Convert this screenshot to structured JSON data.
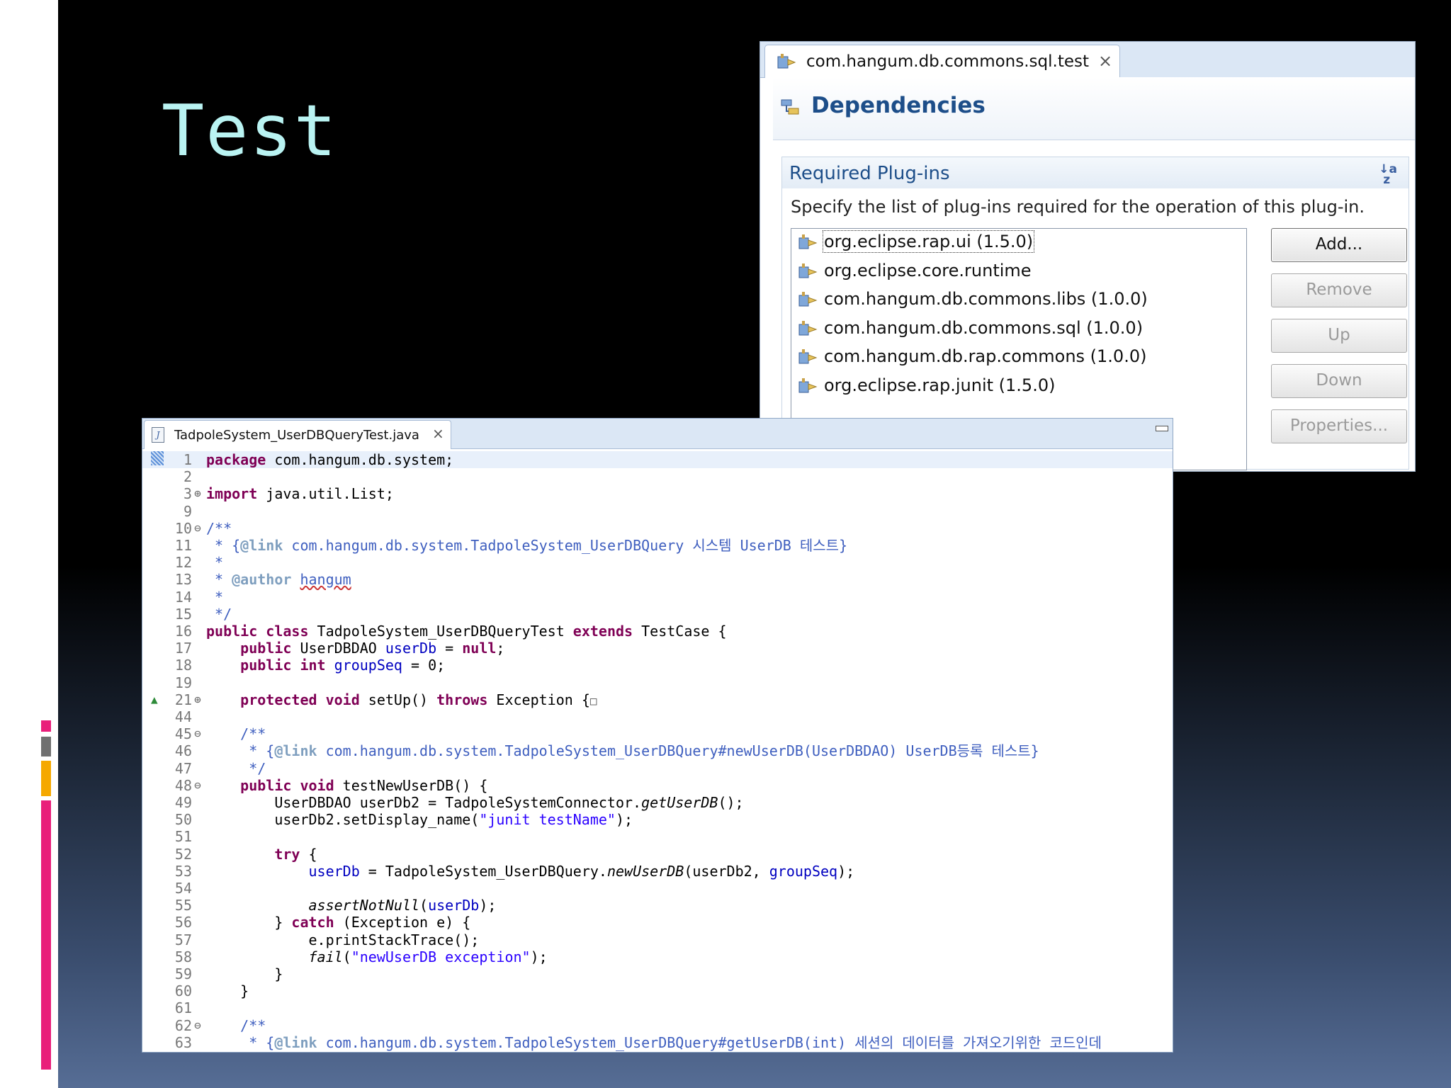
{
  "slide": {
    "title": "Test",
    "colors": {
      "title": "#b9f3f2",
      "accent_pink": "#e91e7a",
      "accent_gray": "#707070",
      "accent_orange": "#f5a800"
    }
  },
  "dependencies_panel": {
    "tab_label": "com.hangum.db.commons.sql.test",
    "close_icon": "×",
    "header_title": "Dependencies",
    "section_title": "Required Plug-ins",
    "sort_icon": "a-z-sort-icon",
    "description": "Specify the list of plug-ins required for the operation of this plug-in.",
    "plugins": [
      "org.eclipse.rap.ui (1.5.0)",
      "org.eclipse.core.runtime",
      "com.hangum.db.commons.libs (1.0.0)",
      "com.hangum.db.commons.sql (1.0.0)",
      "com.hangum.db.rap.commons (1.0.0)",
      "org.eclipse.rap.junit (1.5.0)"
    ],
    "buttons": {
      "add": "Add...",
      "remove": "Remove",
      "up": "Up",
      "down": "Down",
      "properties": "Properties..."
    }
  },
  "editor": {
    "tab_label": "TadpoleSystem_UserDBQueryTest.java",
    "close_icon": "×",
    "lines": [
      {
        "n": "1",
        "m": "",
        "segs": [
          [
            "kw",
            "package"
          ],
          [
            "plain",
            " com.hangum.db.system;"
          ]
        ]
      },
      {
        "n": "2",
        "m": "",
        "segs": []
      },
      {
        "n": "3",
        "m": "⊕",
        "segs": [
          [
            "kw",
            "import"
          ],
          [
            "plain",
            " java.util.List;"
          ]
        ]
      },
      {
        "n": "9",
        "m": "",
        "segs": []
      },
      {
        "n": "10",
        "m": "⊖",
        "segs": [
          [
            "cm",
            "/**"
          ]
        ]
      },
      {
        "n": "11",
        "m": "",
        "segs": [
          [
            "cm",
            " * {"
          ],
          [
            "tag",
            "@link"
          ],
          [
            "cm",
            " com.hangum.db.system.TadpoleSystem_UserDBQuery 시스템 UserDB 테스트}"
          ]
        ]
      },
      {
        "n": "12",
        "m": "",
        "segs": [
          [
            "cm",
            " *"
          ]
        ]
      },
      {
        "n": "13",
        "m": "",
        "segs": [
          [
            "cm",
            " * "
          ],
          [
            "tag",
            "@author"
          ],
          [
            "cm",
            " "
          ],
          [
            "cm squig",
            "hangum"
          ]
        ]
      },
      {
        "n": "14",
        "m": "",
        "segs": [
          [
            "cm",
            " *"
          ]
        ]
      },
      {
        "n": "15",
        "m": "",
        "segs": [
          [
            "cm",
            " */"
          ]
        ]
      },
      {
        "n": "16",
        "m": "",
        "segs": [
          [
            "kw",
            "public class"
          ],
          [
            "plain",
            " TadpoleSystem_UserDBQueryTest "
          ],
          [
            "kw",
            "extends"
          ],
          [
            "plain",
            " TestCase {"
          ]
        ]
      },
      {
        "n": "17",
        "m": "",
        "segs": [
          [
            "plain",
            "    "
          ],
          [
            "kw",
            "public"
          ],
          [
            "plain",
            " UserDBDAO "
          ],
          [
            "fld",
            "userDb"
          ],
          [
            "plain",
            " = "
          ],
          [
            "kw",
            "null"
          ],
          [
            "plain",
            ";"
          ]
        ]
      },
      {
        "n": "18",
        "m": "",
        "segs": [
          [
            "plain",
            "    "
          ],
          [
            "kw",
            "public int"
          ],
          [
            "plain",
            " "
          ],
          [
            "fld",
            "groupSeq"
          ],
          [
            "plain",
            " = 0;"
          ]
        ]
      },
      {
        "n": "19",
        "m": "",
        "segs": []
      },
      {
        "n": "21",
        "m": "⊕",
        "segs": [
          [
            "plain",
            "    "
          ],
          [
            "kw",
            "protected void"
          ],
          [
            "plain",
            " setUp() "
          ],
          [
            "kw",
            "throws"
          ],
          [
            "plain",
            " Exception {"
          ],
          [
            "plain",
            "□"
          ]
        ]
      },
      {
        "n": "44",
        "m": "",
        "segs": []
      },
      {
        "n": "45",
        "m": "⊖",
        "segs": [
          [
            "plain",
            "    "
          ],
          [
            "cm",
            "/**"
          ]
        ]
      },
      {
        "n": "46",
        "m": "",
        "segs": [
          [
            "plain",
            "    "
          ],
          [
            "cm",
            " * {"
          ],
          [
            "tag",
            "@link"
          ],
          [
            "cm",
            " com.hangum.db.system.TadpoleSystem_UserDBQuery#newUserDB(UserDBDAO) UserDB등록 테스트}"
          ]
        ]
      },
      {
        "n": "47",
        "m": "",
        "segs": [
          [
            "plain",
            "    "
          ],
          [
            "cm",
            " */"
          ]
        ]
      },
      {
        "n": "48",
        "m": "⊖",
        "segs": [
          [
            "plain",
            "    "
          ],
          [
            "kw",
            "public void"
          ],
          [
            "plain",
            " testNewUserDB() {"
          ]
        ]
      },
      {
        "n": "49",
        "m": "",
        "segs": [
          [
            "plain",
            "        UserDBDAO userDb2 = TadpoleSystemConnector."
          ],
          [
            "plain it",
            "getUserDB"
          ],
          [
            "plain",
            "();"
          ]
        ]
      },
      {
        "n": "50",
        "m": "",
        "segs": [
          [
            "plain",
            "        userDb2.setDisplay_name("
          ],
          [
            "str",
            "\"junit testName\""
          ],
          [
            "plain",
            ");"
          ]
        ]
      },
      {
        "n": "51",
        "m": "",
        "segs": []
      },
      {
        "n": "52",
        "m": "",
        "segs": [
          [
            "plain",
            "        "
          ],
          [
            "kw",
            "try"
          ],
          [
            "plain",
            " {"
          ]
        ]
      },
      {
        "n": "53",
        "m": "",
        "segs": [
          [
            "plain",
            "            "
          ],
          [
            "fld",
            "userDb"
          ],
          [
            "plain",
            " = TadpoleSystem_UserDBQuery."
          ],
          [
            "plain it",
            "newUserDB"
          ],
          [
            "plain",
            "(userDb2, "
          ],
          [
            "fld",
            "groupSeq"
          ],
          [
            "plain",
            ");"
          ]
        ]
      },
      {
        "n": "54",
        "m": "",
        "segs": []
      },
      {
        "n": "55",
        "m": "",
        "segs": [
          [
            "plain",
            "            "
          ],
          [
            "plain it",
            "assertNotNull"
          ],
          [
            "plain",
            "("
          ],
          [
            "fld",
            "userDb"
          ],
          [
            "plain",
            ");"
          ]
        ]
      },
      {
        "n": "56",
        "m": "",
        "segs": [
          [
            "plain",
            "        } "
          ],
          [
            "kw",
            "catch"
          ],
          [
            "plain",
            " (Exception e) {"
          ]
        ]
      },
      {
        "n": "57",
        "m": "",
        "segs": [
          [
            "plain",
            "            e.printStackTrace();"
          ]
        ]
      },
      {
        "n": "58",
        "m": "",
        "segs": [
          [
            "plain",
            "            "
          ],
          [
            "plain it",
            "fail"
          ],
          [
            "plain",
            "("
          ],
          [
            "str",
            "\"newUserDB exception\""
          ],
          [
            "plain",
            ");"
          ]
        ]
      },
      {
        "n": "59",
        "m": "",
        "segs": [
          [
            "plain",
            "        }"
          ]
        ]
      },
      {
        "n": "60",
        "m": "",
        "segs": [
          [
            "plain",
            "    }"
          ]
        ]
      },
      {
        "n": "61",
        "m": "",
        "segs": []
      },
      {
        "n": "62",
        "m": "⊖",
        "segs": [
          [
            "plain",
            "    "
          ],
          [
            "cm",
            "/**"
          ]
        ]
      },
      {
        "n": "63",
        "m": "",
        "segs": [
          [
            "plain",
            "    "
          ],
          [
            "cm",
            " * {"
          ],
          [
            "tag",
            "@link"
          ],
          [
            "cm",
            " com.hangum.db.system.TadpoleSystem_UserDBQuery#getUserDB(int) 세션의 데이터를 가져오기위한 코드인데"
          ]
        ]
      }
    ]
  }
}
